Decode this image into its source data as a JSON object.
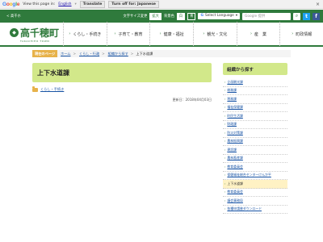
{
  "google_bar": {
    "logo": "Google",
    "text1": "View this page in:",
    "lang": "English",
    "translate": "Translate",
    "turnoff": "Turn off for: Japanese",
    "close": "×"
  },
  "util": {
    "home": "< 高千ホ",
    "font_size_label": "文字サイズ変更",
    "font_size_btn": "拡大",
    "color_label": "背景色",
    "color_btn1": "白",
    "color_btn2": "青",
    "select_language": "Select Language",
    "search_placeholder": "Google 提供"
  },
  "logo": {
    "name": "高千穂町",
    "sub": "TAKACHIHO TOWN"
  },
  "gnav": [
    {
      "label": "くらし・手続き"
    },
    {
      "label": "子育て・教育"
    },
    {
      "label": "健康・福祉"
    },
    {
      "label": "観光・文化"
    },
    {
      "label": "産　業"
    },
    {
      "label": "町政情報"
    }
  ],
  "breadcrumb": {
    "here": "現在のページ",
    "items": [
      "ホーム",
      "くらし・行政",
      "組織から探す"
    ],
    "current": "上下水道課"
  },
  "main": {
    "title": "上下水道課",
    "category": "くらし・手続き",
    "updated": "更新日：2018年04月03日"
  },
  "sidebar": {
    "title": "組織から探す",
    "items": [
      "企画観光課",
      "総務課",
      "税務課",
      "福祉保健課",
      "町民生活課",
      "財政課",
      "防災対策課",
      "農林振興課",
      "建設課",
      "農林畜産課",
      "教育委員会",
      "保健福祉総合センターけんか平",
      "上下水道課",
      "教育委員会",
      "議会事務局",
      "各種申請書ダウンロード"
    ],
    "active_index": 12
  }
}
